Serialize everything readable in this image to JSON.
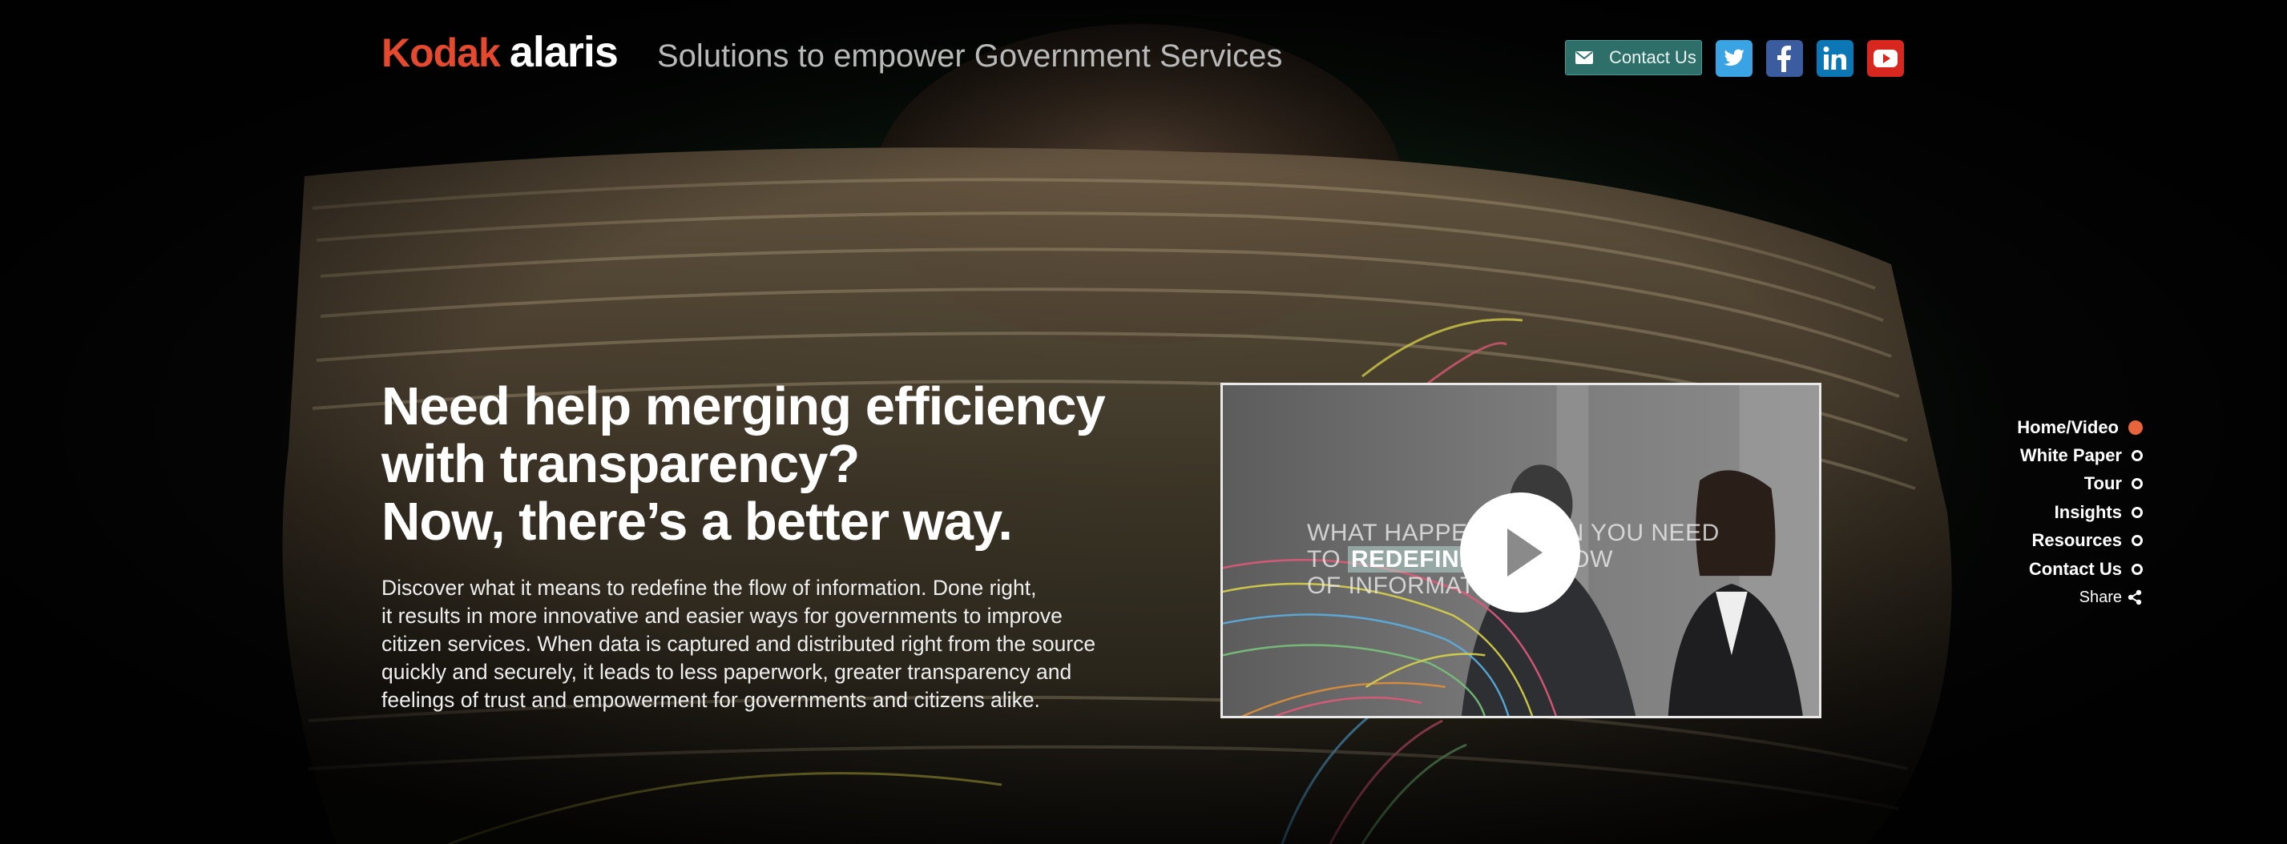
{
  "header": {
    "logo_kodak": "Kodak",
    "logo_alaris": "alaris",
    "tagline": "Solutions to empower Government Services",
    "contact_button": {
      "label": "Contact Us",
      "icon": "envelope-icon",
      "color": "#2e6f6a"
    },
    "social": [
      {
        "name": "twitter",
        "icon": "twitter-icon",
        "color": "#3aa3e3"
      },
      {
        "name": "facebook",
        "icon": "facebook-icon",
        "color": "#3b5da0"
      },
      {
        "name": "linkedin",
        "icon": "linkedin-icon",
        "color": "#0b78b5"
      },
      {
        "name": "youtube",
        "icon": "youtube-icon",
        "color": "#d7271e"
      }
    ]
  },
  "hero": {
    "headline_lines": [
      "Need help merging efficiency",
      "with transparency?",
      "Now, there’s a better way."
    ],
    "body_lines": [
      "Discover what it means to redefine the flow of information. Done right,",
      "it results in more innovative and easier ways for governments to improve",
      "citizen services. When data is captured and distributed right from the source",
      "quickly and securely, it leads to less paperwork, greater transparency and",
      "feelings of trust and empowerment for governments and citizens alike."
    ]
  },
  "video": {
    "line1": "WHAT HAPPENS WHEN YOU NEED",
    "line2_pre": "TO ",
    "line2_highlight": "REDEFINE",
    "line2_post": " THE FLOW",
    "line3": "OF INFORMATION?",
    "play_icon": "play-icon"
  },
  "side_nav": {
    "items": [
      {
        "label": "Home/Video",
        "active": true
      },
      {
        "label": "White Paper",
        "active": false
      },
      {
        "label": "Tour",
        "active": false
      },
      {
        "label": "Insights",
        "active": false
      },
      {
        "label": "Resources",
        "active": false
      },
      {
        "label": "Contact Us",
        "active": false
      }
    ],
    "share_label": "Share",
    "active_color": "#e8653c"
  }
}
